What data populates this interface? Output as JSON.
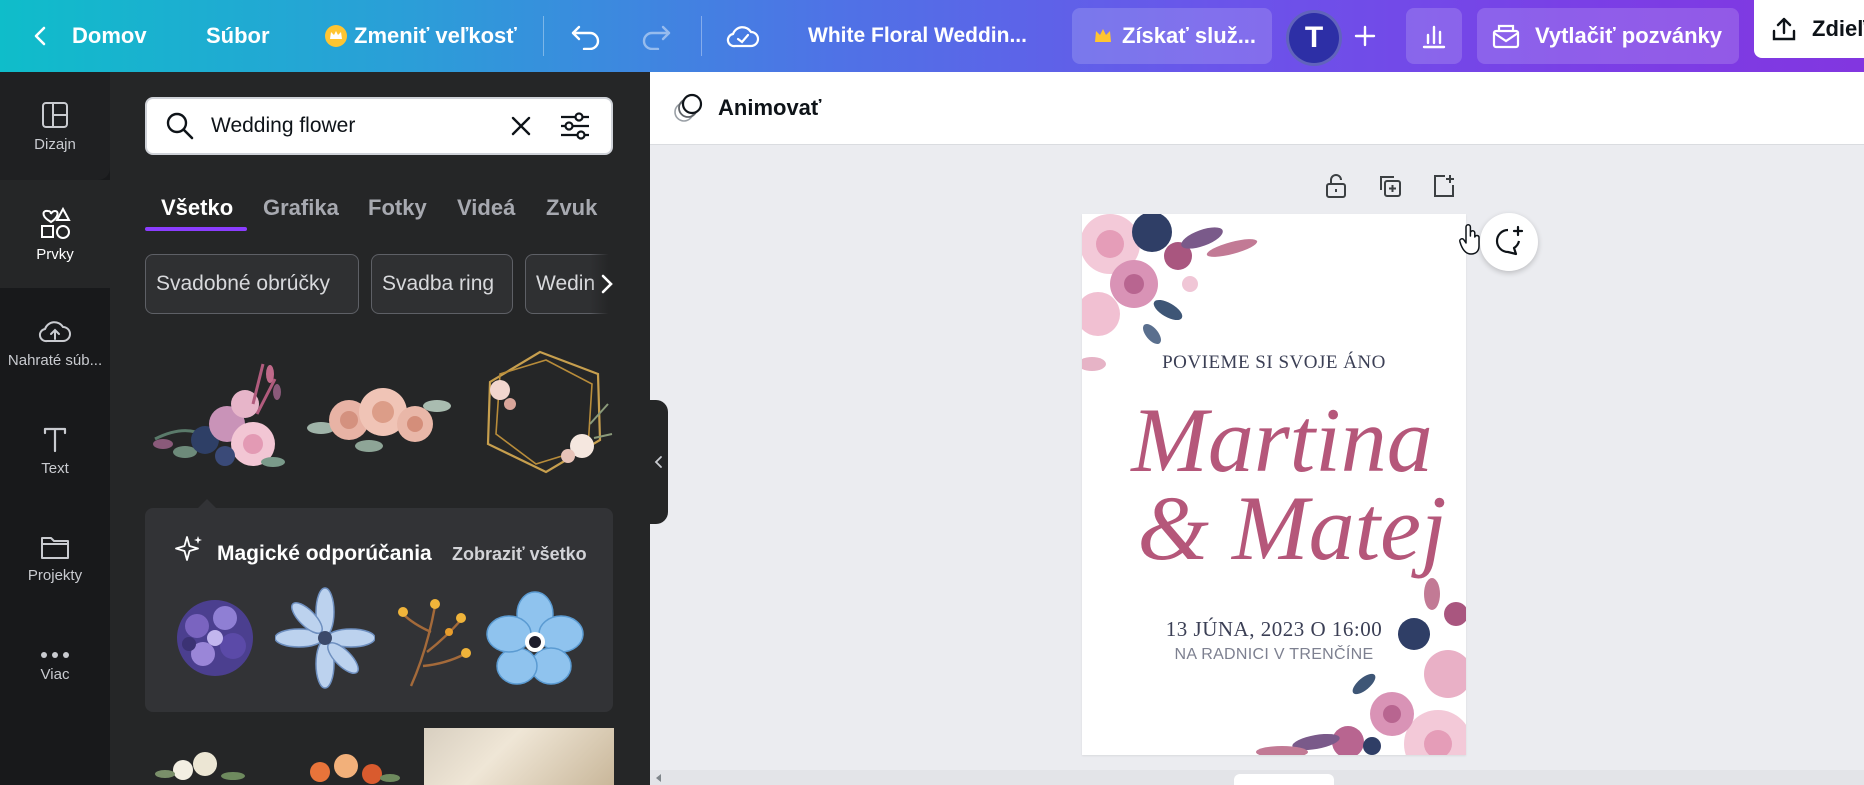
{
  "topbar": {
    "home_label": "Domov",
    "file_label": "Súbor",
    "resize_label": "Zmeniť veľkosť",
    "design_title": "White Floral Weddin...",
    "upgrade_label": "Získať služ...",
    "avatar_letter": "T",
    "print_label": "Vytlačiť pozvánky",
    "share_label": "Zdieľ"
  },
  "rail": {
    "items": [
      {
        "label": "Dizajn",
        "icon": "layout-icon"
      },
      {
        "label": "Prvky",
        "icon": "elements-icon"
      },
      {
        "label": "Nahraté súb...",
        "icon": "cloud-upload-icon"
      },
      {
        "label": "Text",
        "icon": "text-icon"
      },
      {
        "label": "Projekty",
        "icon": "folder-icon"
      },
      {
        "label": "Viac",
        "icon": "more-icon"
      }
    ]
  },
  "panel": {
    "search_value": "Wedding flower",
    "tabs": [
      "Všetko",
      "Grafika",
      "Fotky",
      "Videá",
      "Zvuk"
    ],
    "chips": [
      "Svadobné obrúčky",
      "Svadba ring",
      "Wedin"
    ],
    "magic_title": "Magické odporúčania",
    "magic_link": "Zobraziť všetko"
  },
  "editor": {
    "animate_label": "Animovať"
  },
  "card": {
    "line1": "POVIEME SI SVOJE ÁNO",
    "name1": "Martina",
    "name2": "& Matej",
    "date": "13 JÚNA, 2023 O 16:00",
    "place": "NA RADNICI V TRENČÍNE"
  },
  "colors": {
    "accent": "#8b3dff",
    "script_name": "#b5577a",
    "avatar_bg": "#2d2fa6"
  }
}
